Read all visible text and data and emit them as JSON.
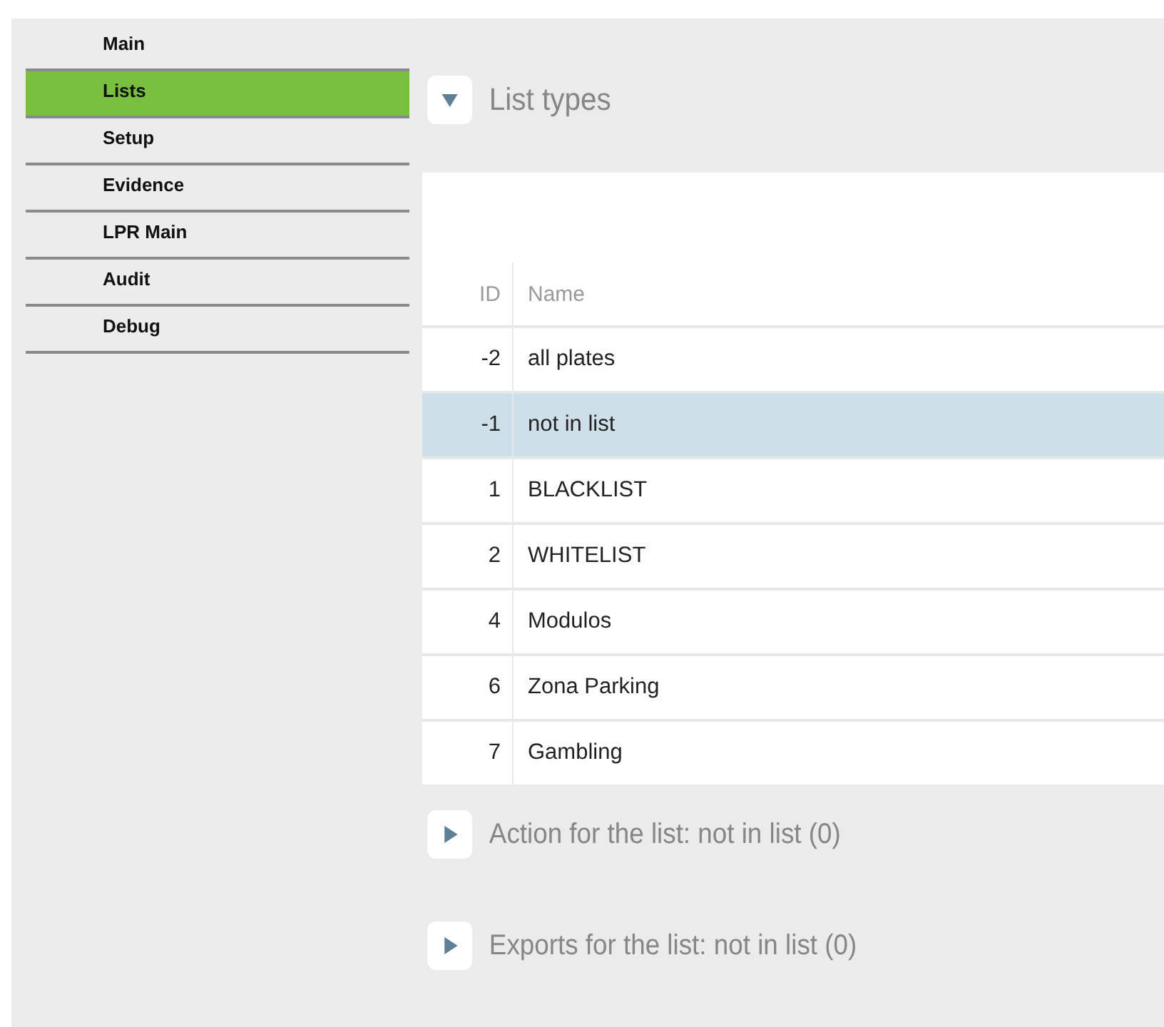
{
  "sidebar": {
    "items": [
      {
        "label": "Main",
        "selected": false
      },
      {
        "label": "Lists",
        "selected": true
      },
      {
        "label": "Setup",
        "selected": false
      },
      {
        "label": "Evidence",
        "selected": false
      },
      {
        "label": "LPR Main",
        "selected": false
      },
      {
        "label": "Audit",
        "selected": false
      },
      {
        "label": "Debug",
        "selected": false
      }
    ]
  },
  "list_types": {
    "title": "List types",
    "expanded": true
  },
  "table": {
    "columns": [
      "ID",
      "Name"
    ],
    "rows": [
      {
        "id": "-2",
        "name": "all plates",
        "selected": false
      },
      {
        "id": "-1",
        "name": "not in list",
        "selected": true
      },
      {
        "id": "1",
        "name": "BLACKLIST",
        "selected": false
      },
      {
        "id": "2",
        "name": "WHITELIST",
        "selected": false
      },
      {
        "id": "4",
        "name": "Modulos",
        "selected": false
      },
      {
        "id": "6",
        "name": "Zona Parking",
        "selected": false
      },
      {
        "id": "7",
        "name": "Gambling",
        "selected": false
      }
    ]
  },
  "sections": [
    {
      "title": "Action for the list: not in list (0)",
      "expanded": false
    },
    {
      "title": "Exports for the list: not in list (0)",
      "expanded": false
    }
  ]
}
